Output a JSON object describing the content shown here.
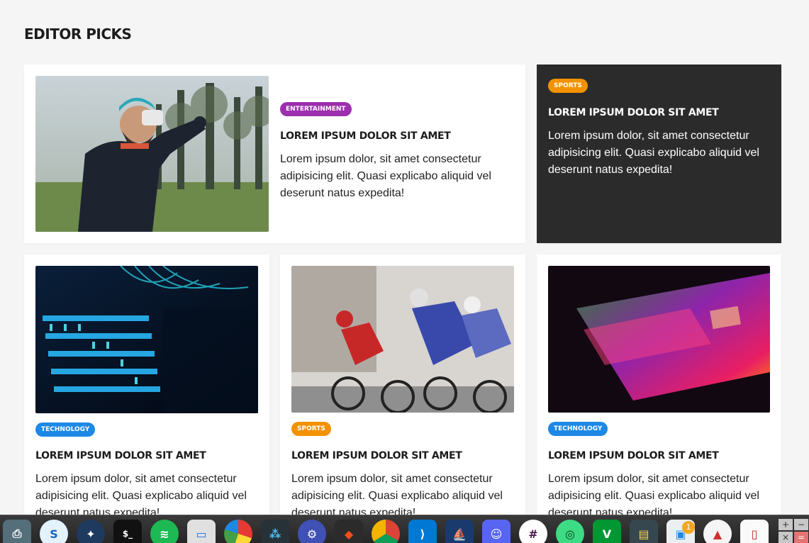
{
  "section": {
    "title": "EDITOR PICKS"
  },
  "featured": {
    "badge": "ENTERTAINMENT",
    "title": "LOREM IPSUM DOLOR SIT AMET",
    "text": "Lorem ipsum dolor, sit amet consectetur adipisicing elit. Quasi explicabo aliquid vel deserunt natus expedita!",
    "badge_color": "#9b2fae"
  },
  "side": {
    "badge": "SPORTS",
    "title": "LOREM IPSUM DOLOR SIT AMET",
    "text": "Lorem ipsum dolor, sit amet consectetur adipisicing elit. Quasi explicabo aliquid vel deserunt natus expedita!",
    "badge_color": "#f39200"
  },
  "cards": [
    {
      "badge": "TECHNOLOGY",
      "title": "LOREM IPSUM DOLOR SIT AMET",
      "text": "Lorem ipsum dolor, sit amet consectetur adipisicing elit. Quasi explicabo aliquid vel deserunt natus expedita!",
      "badge_color": "#1e88e5"
    },
    {
      "badge": "SPORTS",
      "title": "LOREM IPSUM DOLOR SIT AMET",
      "text": "Lorem ipsum dolor, sit amet consectetur adipisicing elit. Quasi explicabo aliquid vel deserunt natus expedita!",
      "badge_color": "#f39200"
    },
    {
      "badge": "TECHNOLOGY",
      "title": "LOREM IPSUM DOLOR SIT AMET",
      "text": "Lorem ipsum dolor, sit amet consectetur adipisicing elit. Quasi explicabo aliquid vel deserunt natus expedita!",
      "badge_color": "#1e88e5"
    }
  ],
  "dock": {
    "items": [
      "printer-icon",
      "simplenote-icon",
      "kde-icon",
      "terminal-icon",
      "spotify-icon",
      "files-icon",
      "chart-icon",
      "network-icon",
      "settings-icon",
      "figma-icon",
      "chrome-icon",
      "vscode-icon",
      "boat-icon",
      "discord-icon",
      "slack-icon",
      "android-studio-icon",
      "vim-icon",
      "monitor-icon",
      "updates-icon",
      "mushroom-icon",
      "document-icon"
    ],
    "updates_badge": "1",
    "calculator_keys": [
      "+",
      "−",
      "×",
      "="
    ]
  }
}
